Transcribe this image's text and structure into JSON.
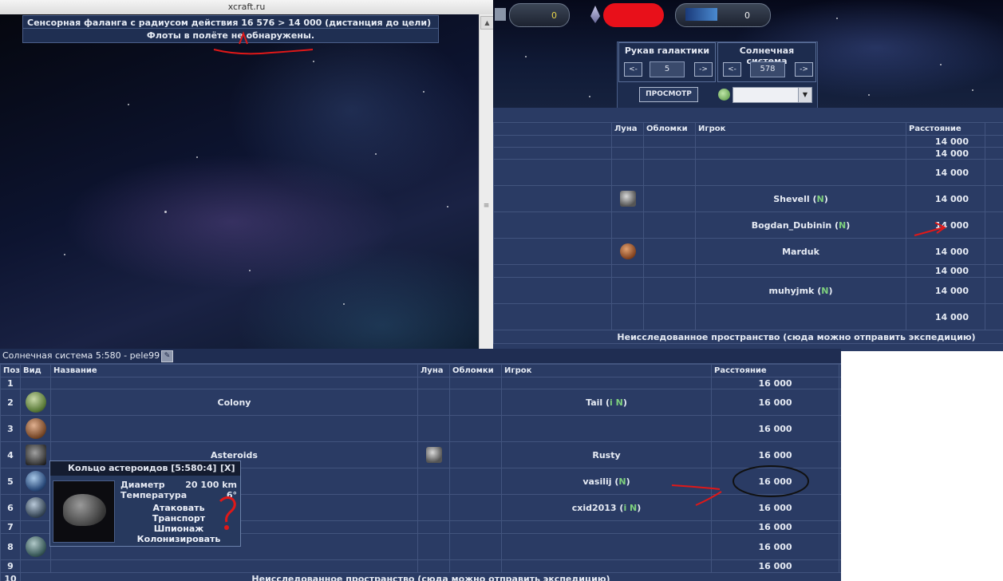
{
  "popup": {
    "title": "xcraft.ru",
    "phalanx_line": "Сенсорная фаланга с радиусом действия 16 576 > 14 000 (дистанция до цели)",
    "fleets_line": "Флоты в полёте не обнаружены."
  },
  "galaxy": {
    "resources": {
      "slot1_value": "0",
      "slot2_value": "0"
    },
    "galaxy_label": "Рукав галактики",
    "galaxy_value": "5",
    "system_label": "Солнечная система",
    "system_value": "578",
    "prev_btn": "<-",
    "next_btn": "->",
    "view_btn": "ПРОСМОТР",
    "headers": {
      "moon": "Луна",
      "debris": "Обломки",
      "player": "Игрок",
      "distance": "Расстояние"
    },
    "rows": [
      {
        "player": "",
        "n": "",
        "distance": "14 000"
      },
      {
        "player": "",
        "n": "",
        "distance": "14 000"
      },
      {
        "player": "",
        "n": "",
        "distance": "14 000"
      },
      {
        "player": "Shevell",
        "n": "N",
        "distance": "14 000"
      },
      {
        "player": "Bogdan_Dubinin",
        "n": "N",
        "distance": "14 000"
      },
      {
        "player": "Marduk",
        "n": "",
        "distance": "14 000"
      },
      {
        "player": "",
        "n": "",
        "distance": "14 000"
      },
      {
        "player": "muhyjmk",
        "n": "N",
        "distance": "14 000"
      },
      {
        "player": "",
        "n": "",
        "distance": "14 000"
      }
    ],
    "footer": "Неисследованное пространство (сюда можно отправить экспедицию)"
  },
  "system": {
    "title": "Солнечная система 5:580 - pele99",
    "headers": {
      "pos": "Поз",
      "view": "Вид",
      "name": "Название",
      "moon": "Луна",
      "debris": "Обломки",
      "player": "Игрок",
      "distance": "Расстояние"
    },
    "rows": [
      {
        "pos": "1",
        "name": "",
        "player": "",
        "distance": "16 000"
      },
      {
        "pos": "2",
        "name": "Colony",
        "player": "Tail",
        "tags": "i N",
        "distance": "16 000"
      },
      {
        "pos": "3",
        "name": "",
        "player": "",
        "distance": "16 000"
      },
      {
        "pos": "4",
        "name": "Asteroids",
        "player": "Rusty",
        "distance": "16 000"
      },
      {
        "pos": "5",
        "name": "",
        "player": "vasilij",
        "tags": "N",
        "distance": "16 000"
      },
      {
        "pos": "6",
        "name": "",
        "player": "cxid2013",
        "tags": "i N",
        "distance": "16 000"
      },
      {
        "pos": "7",
        "name": "",
        "player": "",
        "distance": "16 000"
      },
      {
        "pos": "8",
        "name": "",
        "player": "",
        "distance": "16 000"
      },
      {
        "pos": "9",
        "name": "",
        "player": "",
        "distance": "16 000"
      }
    ],
    "footer": "Неисследованное пространство (сюда можно отправить экспедицию)",
    "footer_pos": "10"
  },
  "tooltip": {
    "title": "Кольцо астероидов [5:580:4]",
    "close": "[X]",
    "diameter_label": "Диаметр",
    "diameter_value": "20 100 km",
    "temperature_label": "Температура",
    "temperature_value": "6°",
    "actions": [
      "Атаковать",
      "Транспорт",
      "Шпионаж",
      "Колонизировать"
    ]
  },
  "colors": {
    "panel_bg": "#2a3b64",
    "border": "#42547e",
    "n_tag": "#7ed07e",
    "annotation_red": "#e01818"
  }
}
